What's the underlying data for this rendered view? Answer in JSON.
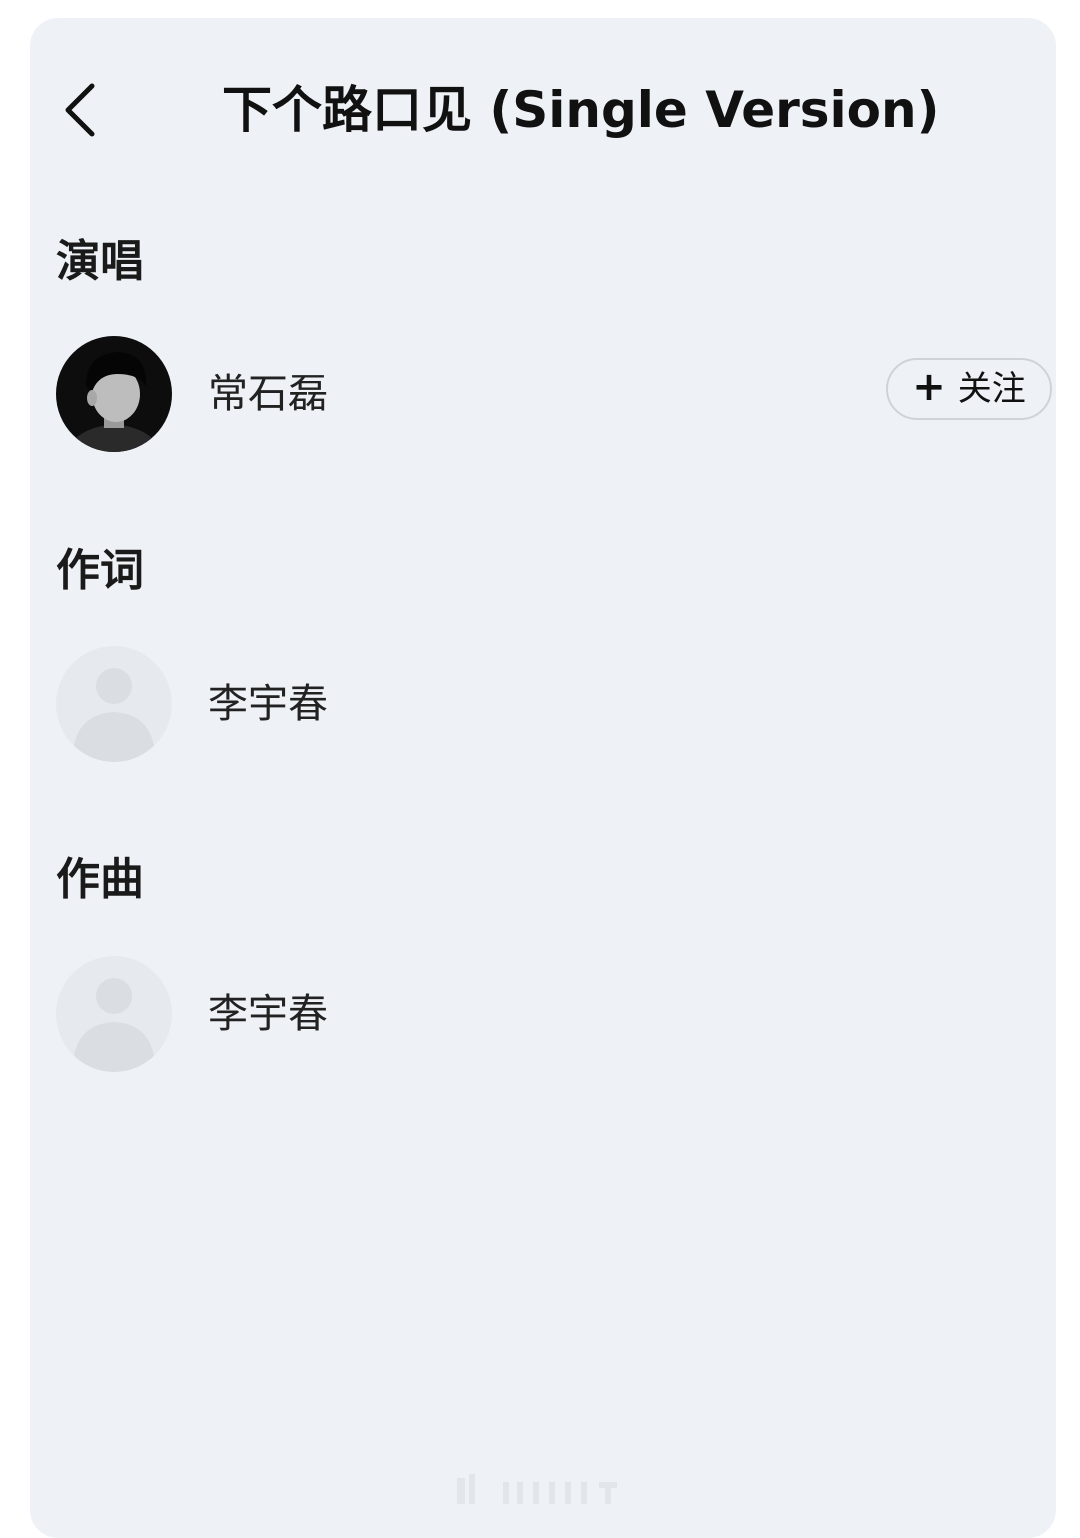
{
  "header": {
    "title": "下个路口见 (Single Version)",
    "back_icon": "chevron-left-icon"
  },
  "sections": [
    {
      "title": "演唱",
      "people": [
        {
          "name": "常石磊",
          "avatar": "artist-photo",
          "follow_label": "关注",
          "follow_icon": "plus-icon"
        }
      ]
    },
    {
      "title": "作词",
      "people": [
        {
          "name": "李宇春",
          "avatar": "default-avatar-icon"
        }
      ]
    },
    {
      "title": "作曲",
      "people": [
        {
          "name": "李宇春",
          "avatar": "default-avatar-icon"
        }
      ]
    }
  ],
  "colors": {
    "background": "#eef2f6",
    "text": "#111111",
    "follow_border": "#cfd3d8",
    "placeholder_avatar": "#e3e6ea"
  }
}
